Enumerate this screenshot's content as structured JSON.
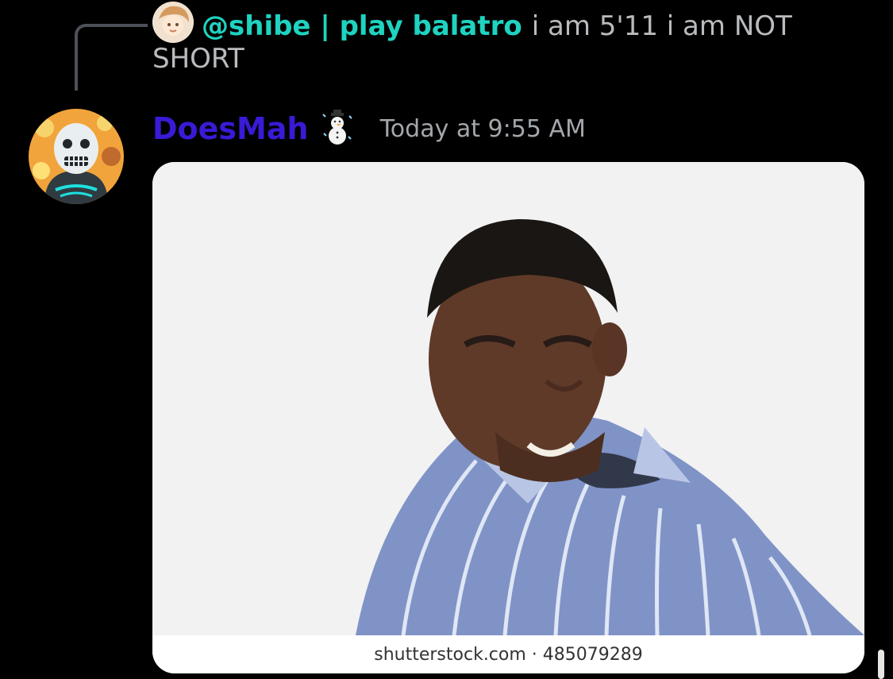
{
  "reply": {
    "username": "@shibe | play balatro",
    "text": "i am 5'11 i am NOT SHORT"
  },
  "message": {
    "username": "DoesMah",
    "badge_icon": "snowman-icon",
    "timestamp": "Today at 9:55 AM"
  },
  "attachment": {
    "watermark": "shutterstock.com · 485079289"
  },
  "colors": {
    "background": "#000000",
    "reply_username": "#1ed3c0",
    "message_username": "#3a1ad6",
    "timestamp": "#a3a6aa"
  }
}
